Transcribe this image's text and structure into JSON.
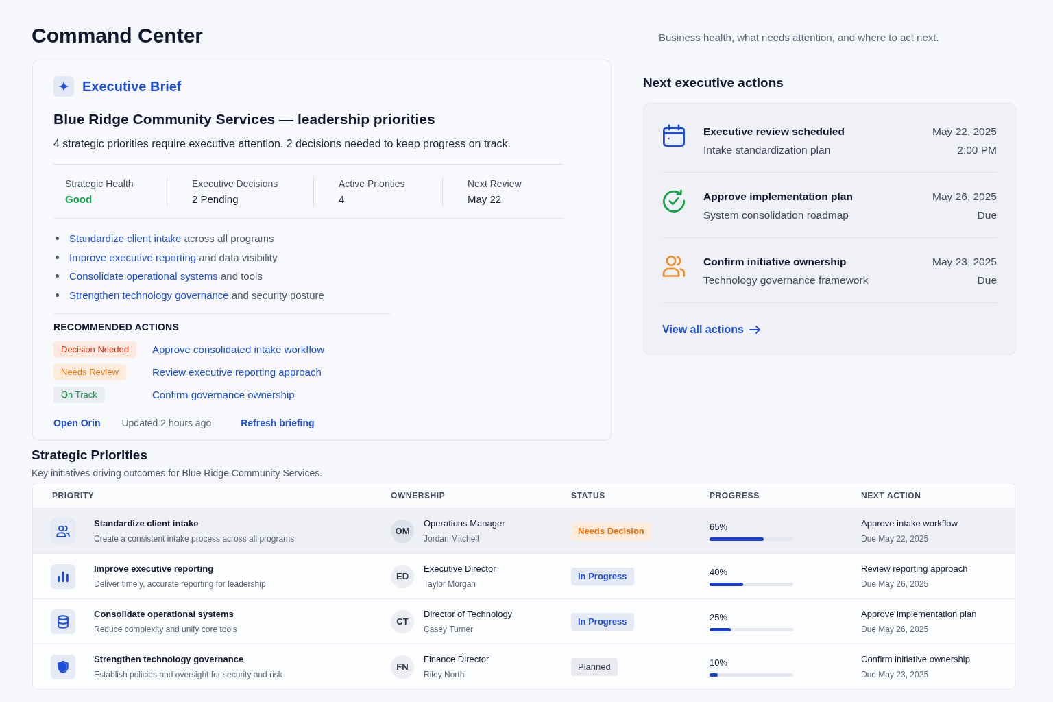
{
  "header": {
    "title": "Command Center",
    "subtitle": "Business health, what needs attention, and where to act next."
  },
  "brief": {
    "label": "Executive Brief",
    "heading": "Blue Ridge Community Services — leadership priorities",
    "summary": "4 strategic priorities require executive attention. 2 decisions needed to keep progress on track.",
    "metrics": [
      {
        "label": "Strategic Health",
        "value": "Good",
        "kind": "positive"
      },
      {
        "label": "Executive Decisions",
        "value": "2 Pending",
        "kind": "neutral"
      },
      {
        "label": "Active Priorities",
        "value": "4",
        "kind": "neutral"
      },
      {
        "label": "Next Review",
        "value": "May 22",
        "kind": "neutral"
      }
    ],
    "priorities": [
      {
        "link": "Standardize client intake",
        "text": "across all programs"
      },
      {
        "link": "Improve executive reporting",
        "text": "and data visibility"
      },
      {
        "link": "Consolidate operational systems",
        "text": "and tools"
      },
      {
        "link": "Strengthen technology governance",
        "text": "and security posture"
      }
    ],
    "recommended": {
      "title": "RECOMMENDED ACTIONS",
      "items": [
        {
          "tag": "Decision Needed",
          "kind": "danger",
          "action": "Approve consolidated intake workflow"
        },
        {
          "tag": "Needs Review",
          "kind": "warning",
          "action": "Review executive reporting approach"
        },
        {
          "tag": "On Track",
          "kind": "success",
          "action": "Confirm governance ownership"
        }
      ]
    },
    "footer": {
      "open_link": "Open Orin",
      "updated": "Updated 2 hours ago",
      "refresh_link": "Refresh briefing"
    }
  },
  "next_actions": {
    "title": "Next executive actions",
    "items": [
      {
        "kind": "calendar",
        "title": "Executive review scheduled",
        "detail": "Intake standardization plan",
        "date": "May 22, 2025",
        "note": "2:00 PM"
      },
      {
        "kind": "approval",
        "title": "Approve implementation plan",
        "detail": "System consolidation roadmap",
        "date": "May 26, 2025",
        "note": "Due"
      },
      {
        "kind": "people",
        "title": "Confirm initiative ownership",
        "detail": "Technology governance framework",
        "date": "May 23, 2025",
        "note": "Due"
      }
    ],
    "link": "View all actions"
  },
  "priorities": {
    "title": "Strategic Priorities",
    "subtitle": "Key initiatives driving outcomes for Blue Ridge Community Services.",
    "columns": [
      "PRIORITY",
      "OWNERSHIP",
      "STATUS",
      "PROGRESS",
      "NEXT ACTION"
    ],
    "rows": [
      {
        "selected": true,
        "kind": "people",
        "name": "Standardize client intake",
        "description": "Create a consistent intake process across all programs",
        "initials": "OM",
        "role": "Operations Manager",
        "owner": "Jordan Mitchell",
        "status": {
          "label": "Needs Decision",
          "kind": "decision"
        },
        "progress": "65%",
        "level": 0.65,
        "next_action": "Approve intake workflow",
        "due": "Due May 22, 2025"
      },
      {
        "selected": false,
        "kind": "chart",
        "name": "Improve executive reporting",
        "description": "Deliver timely, accurate reporting for leadership",
        "initials": "ED",
        "role": "Executive Director",
        "owner": "Taylor Morgan",
        "status": {
          "label": "In Progress",
          "kind": "active"
        },
        "progress": "40%",
        "level": 0.4,
        "next_action": "Review reporting approach",
        "due": "Due May 26, 2025"
      },
      {
        "selected": false,
        "kind": "database",
        "name": "Consolidate operational systems",
        "description": "Reduce complexity and unify core tools",
        "initials": "CT",
        "role": "Director of Technology",
        "owner": "Casey Turner",
        "status": {
          "label": "In Progress",
          "kind": "active"
        },
        "progress": "25%",
        "level": 0.25,
        "next_action": "Approve implementation plan",
        "due": "Due May 26, 2025"
      },
      {
        "selected": false,
        "kind": "shield",
        "name": "Strengthen technology governance",
        "description": "Establish policies and oversight for security and risk",
        "initials": "FN",
        "role": "Finance Director",
        "owner": "Riley North",
        "status": {
          "label": "Planned",
          "kind": "planned"
        },
        "progress": "10%",
        "level": 0.1,
        "next_action": "Confirm initiative ownership",
        "due": "Due May 23, 2025"
      }
    ]
  }
}
